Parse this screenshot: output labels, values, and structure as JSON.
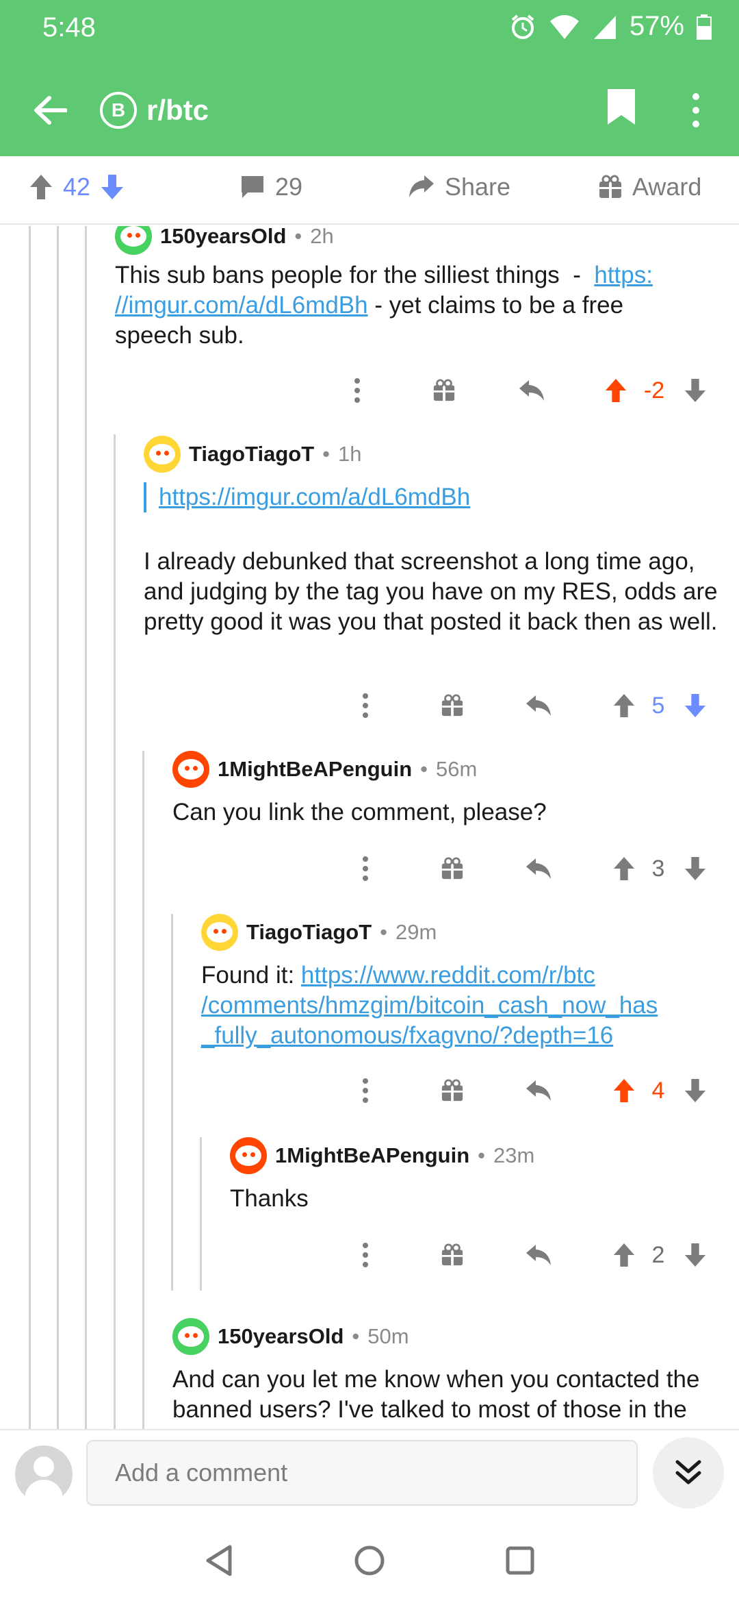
{
  "status_bar": {
    "time": "5:48",
    "battery": "57%"
  },
  "app_bar": {
    "subreddit": "r/btc",
    "sub_icon_glyph": "B"
  },
  "action_bar": {
    "score": "42",
    "comments": "29",
    "share_label": "Share",
    "award_label": "Award"
  },
  "comments": [
    {
      "author": "150yearsOld",
      "time": "2h",
      "avatar": "green",
      "text_before": "This sub bans people for the silliest things  -  ",
      "link": "https://imgur.com/a/dL6mdBh",
      "link_line1": "https:",
      "link_line2": "//imgur.com/a/dL6mdBh",
      "text_after_line2": " - yet claims to be a free",
      "text_line3": "speech sub.",
      "score": "-2"
    },
    {
      "author": "TiagoTiagoT",
      "time": "1h",
      "avatar": "yellow",
      "quote_link": "https://imgur.com/a/dL6mdBh",
      "text": "I already debunked that screenshot a long time ago, and judging by the tag you have on my RES, odds are pretty good it was you that posted it back then as well.",
      "score": "5"
    },
    {
      "author": "1MightBeAPenguin",
      "time": "56m",
      "avatar": "red",
      "text": "Can you link the comment, please?",
      "score": "3"
    },
    {
      "author": "TiagoTiagoT",
      "time": "29m",
      "avatar": "yellow",
      "text_before": "Found it: ",
      "link_line1": "https://www.reddit.com/r/btc",
      "link_line2": "/comments/hmzgim/bitcoin_cash_now_has",
      "link_line3": "_fully_autonomous/fxagvno/?depth=16",
      "score": "4"
    },
    {
      "author": "1MightBeAPenguin",
      "time": "23m",
      "avatar": "red",
      "text": "Thanks",
      "score": "2"
    },
    {
      "author": "150yearsOld",
      "time": "50m",
      "avatar": "green",
      "text": "And can you let me know when you contacted the banned users? I've talked to most of those in the above image."
    }
  ],
  "bottom_bar": {
    "placeholder": "Add a comment"
  },
  "colors": {
    "header_green": "#5ec972",
    "upvote": "#ff4500",
    "downvote": "#6a8cff",
    "link": "#3a9de0"
  }
}
